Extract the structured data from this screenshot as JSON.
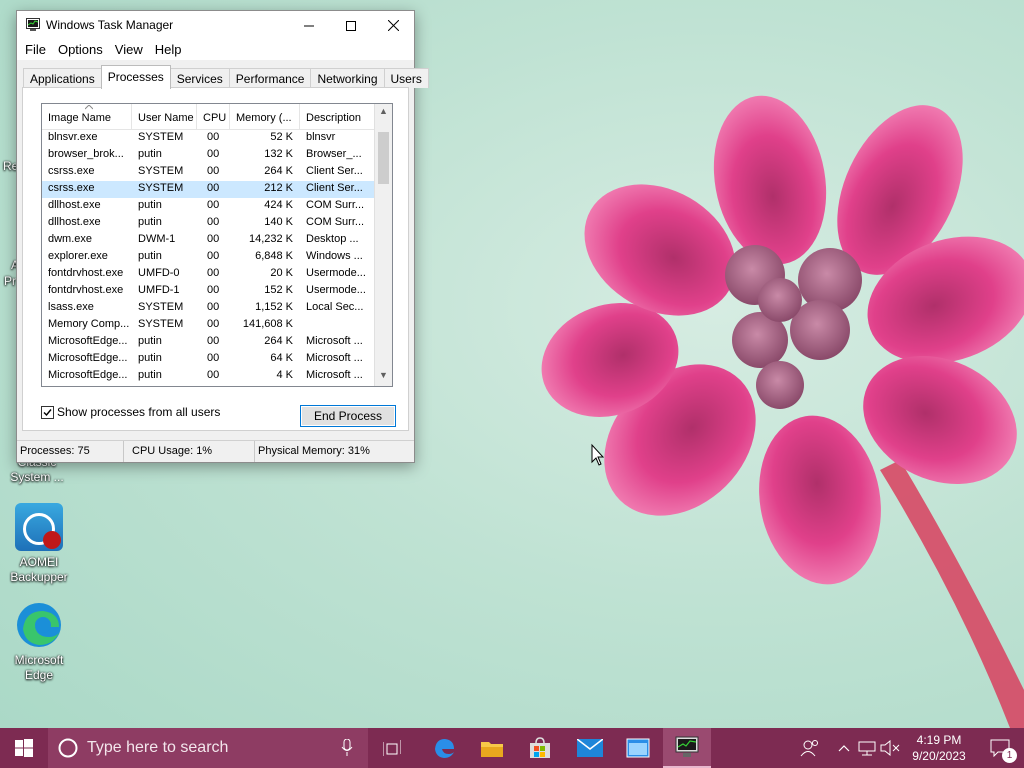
{
  "desktop": {
    "icons": [
      {
        "label_line1": "Classic",
        "label_line2": "System ..."
      },
      {
        "label_line1": "AOMEI",
        "label_line2": "Backupper"
      },
      {
        "label_line1": "Microsoft",
        "label_line2": "Edge"
      }
    ],
    "partial_labels": [
      "Re",
      "A",
      "Pr"
    ]
  },
  "window": {
    "title": "Windows Task Manager",
    "menu": [
      "File",
      "Options",
      "View",
      "Help"
    ],
    "tabs": [
      "Applications",
      "Processes",
      "Services",
      "Performance",
      "Networking",
      "Users"
    ],
    "active_tab": "Processes",
    "columns": [
      "Image Name",
      "User Name",
      "CPU",
      "Memory (...",
      "Description"
    ],
    "rows": [
      {
        "image": "blnsvr.exe",
        "user": "SYSTEM",
        "cpu": "00",
        "memory": "52 K",
        "desc": "blnsvr"
      },
      {
        "image": "browser_brok...",
        "user": "putin",
        "cpu": "00",
        "memory": "132 K",
        "desc": "Browser_..."
      },
      {
        "image": "csrss.exe",
        "user": "SYSTEM",
        "cpu": "00",
        "memory": "264 K",
        "desc": "Client Ser..."
      },
      {
        "image": "csrss.exe",
        "user": "SYSTEM",
        "cpu": "00",
        "memory": "212 K",
        "desc": "Client Ser..."
      },
      {
        "image": "dllhost.exe",
        "user": "putin",
        "cpu": "00",
        "memory": "424 K",
        "desc": "COM Surr..."
      },
      {
        "image": "dllhost.exe",
        "user": "putin",
        "cpu": "00",
        "memory": "140 K",
        "desc": "COM Surr..."
      },
      {
        "image": "dwm.exe",
        "user": "DWM-1",
        "cpu": "00",
        "memory": "14,232 K",
        "desc": "Desktop ..."
      },
      {
        "image": "explorer.exe",
        "user": "putin",
        "cpu": "00",
        "memory": "6,848 K",
        "desc": "Windows ..."
      },
      {
        "image": "fontdrvhost.exe",
        "user": "UMFD-0",
        "cpu": "00",
        "memory": "20 K",
        "desc": "Usermode..."
      },
      {
        "image": "fontdrvhost.exe",
        "user": "UMFD-1",
        "cpu": "00",
        "memory": "152 K",
        "desc": "Usermode..."
      },
      {
        "image": "lsass.exe",
        "user": "SYSTEM",
        "cpu": "00",
        "memory": "1,152 K",
        "desc": "Local Sec..."
      },
      {
        "image": "Memory Comp...",
        "user": "SYSTEM",
        "cpu": "00",
        "memory": "141,608 K",
        "desc": ""
      },
      {
        "image": "MicrosoftEdge...",
        "user": "putin",
        "cpu": "00",
        "memory": "264 K",
        "desc": "Microsoft ..."
      },
      {
        "image": "MicrosoftEdge...",
        "user": "putin",
        "cpu": "00",
        "memory": "64 K",
        "desc": "Microsoft ..."
      },
      {
        "image": "MicrosoftEdge...",
        "user": "putin",
        "cpu": "00",
        "memory": "4 K",
        "desc": "Microsoft ..."
      }
    ],
    "selected_row": 3,
    "show_all_label": "Show processes from all users",
    "show_all_checked": true,
    "end_process_label": "End Process",
    "status": {
      "processes": "Processes: 75",
      "cpu": "CPU Usage: 1%",
      "memory": "Physical Memory: 31%"
    }
  },
  "taskbar": {
    "search_placeholder": "Type here to search",
    "clock_time": "4:19 PM",
    "clock_date": "9/20/2023",
    "notification_count": "1",
    "pinned": [
      "microphone-icon",
      "task-view-icon",
      "edge-icon",
      "file-explorer-icon",
      "store-icon",
      "mail-icon",
      "window-app-icon",
      "task-manager-icon"
    ]
  },
  "colors": {
    "taskbar": "#7d2b52",
    "selection": "#cce8ff",
    "accent": "#0078d7"
  }
}
